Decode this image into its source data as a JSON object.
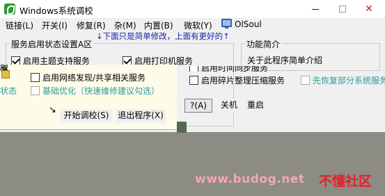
{
  "window": {
    "title": "Windows系统调校",
    "close": "✕"
  },
  "menu": [
    "链接(L)",
    "开关(I)",
    "修复(R)",
    "杂(M)",
    "内置(B)",
    "微软(Y)",
    "OlSoul"
  ],
  "hint": "↓下面只是简单修改，上面有更好的↑",
  "services_group": {
    "legend": "服务启用状态设置A区",
    "theme_support": "启用主题支持服务",
    "print_service": "启用打印机服务",
    "network_discovery": "启用网络发现/共享相关服务",
    "basic_optimize": "基础优化（快速维修建议勾选）",
    "status_fragment": "状态",
    "clipped_fragment": "服务"
  },
  "intro_group": {
    "legend": "功能简介",
    "text": "关于此程序简单介绍",
    "clipped_text": "启用时间同步服务",
    "defrag": "启用碎片整理压缩服务",
    "restore_first": "先恢复部分系统服务"
  },
  "buttons": {
    "start": "开始调校(S)",
    "exit": "退出程序(X)",
    "help": "?(A)",
    "shutdown": "关机",
    "restart": "重启"
  },
  "watermark": {
    "url": "www.budog.net",
    "name": "不懂社区"
  },
  "colors": {
    "hint_text": "#1a22b0",
    "overlay_bg": "#fefbe9",
    "teal_text": "#2c9a9a",
    "watermark_url": "#f4a6b4",
    "watermark_name": "#e8202a"
  }
}
